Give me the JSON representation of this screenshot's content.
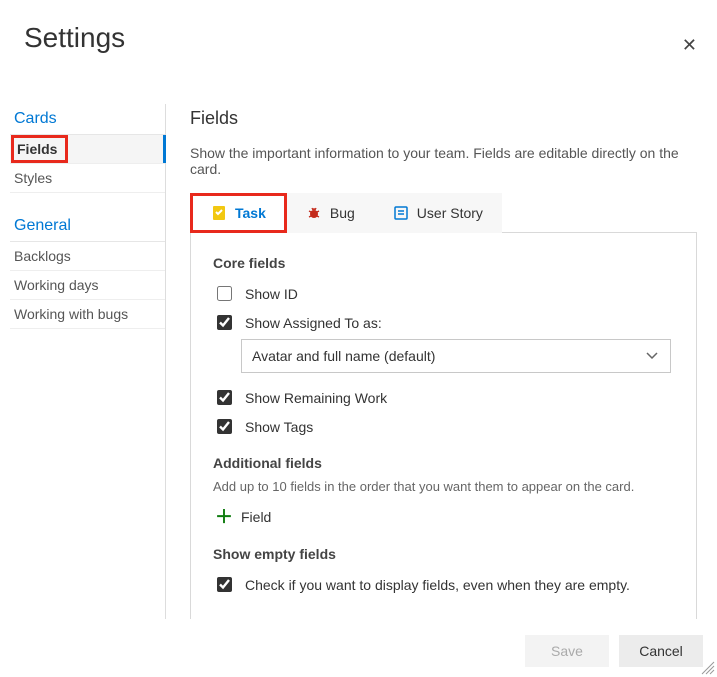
{
  "window": {
    "title": "Settings"
  },
  "sidebar": {
    "cards_head": "Cards",
    "fields": "Fields",
    "styles": "Styles",
    "general_head": "General",
    "backlogs": "Backlogs",
    "working_days": "Working days",
    "working_bugs": "Working with bugs"
  },
  "main": {
    "heading": "Fields",
    "description": "Show the important information to your team. Fields are editable directly on the card.",
    "tabs": {
      "task": "Task",
      "bug": "Bug",
      "user_story": "User Story"
    },
    "core": {
      "title": "Core fields",
      "show_id": "Show ID",
      "show_assigned": "Show Assigned To as:",
      "assigned_option": "Avatar and full name (default)",
      "show_remaining": "Show Remaining Work",
      "show_tags": "Show Tags"
    },
    "additional": {
      "title": "Additional fields",
      "hint": "Add up to 10 fields in the order that you want them to appear on the card.",
      "add_label": "Field"
    },
    "empty": {
      "title": "Show empty fields",
      "label": "Check if you want to display fields, even when they are empty."
    }
  },
  "footer": {
    "save": "Save",
    "cancel": "Cancel"
  }
}
